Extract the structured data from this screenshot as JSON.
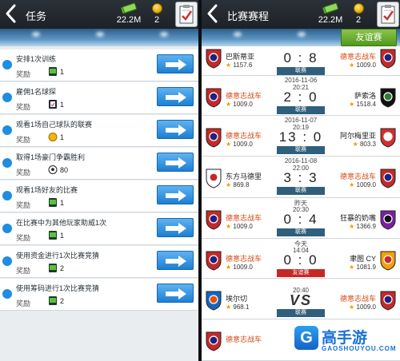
{
  "left": {
    "header": {
      "title": "任务",
      "money": "22.2M",
      "coins": "2"
    },
    "tasks": [
      {
        "desc": "安排1次训练",
        "reward_label": "奖励",
        "reward_icon": "money-icon",
        "reward_value": "1"
      },
      {
        "desc": "雇佣1名球探",
        "reward_label": "奖励",
        "reward_icon": "clipboard-icon",
        "reward_value": "1"
      },
      {
        "desc": "观看1场自己球队的联赛",
        "reward_label": "奖励",
        "reward_icon": "coin-icon",
        "reward_value": "1"
      },
      {
        "desc": "取得1场豪门争霸胜利",
        "reward_label": "奖励",
        "reward_icon": "football-icon",
        "reward_value": "80"
      },
      {
        "desc": "观看1场好友的比赛",
        "reward_label": "奖励",
        "reward_icon": "money-icon",
        "reward_value": "1"
      },
      {
        "desc": "在比赛中为其他玩家助威1次",
        "reward_label": "奖励",
        "reward_icon": "money-icon",
        "reward_value": "1"
      },
      {
        "desc": "使用资金进行1次比赛竞猜",
        "reward_label": "奖励",
        "reward_icon": "money-icon",
        "reward_value": "2"
      },
      {
        "desc": "使用筹码进行1次比赛竞猜",
        "reward_label": "奖励",
        "reward_icon": "money-icon",
        "reward_value": "2"
      }
    ]
  },
  "right": {
    "header": {
      "title": "比赛赛程",
      "money": "22.2M",
      "coins": "2"
    },
    "friendly_button": "友谊赛",
    "matches": [
      {
        "date": "",
        "time": "",
        "home": "巴斯蒂亚",
        "home_rating": "1157.6",
        "away": "德意志战车",
        "away_rating": "1009.0",
        "score": "0 : 8",
        "tag": "联赛",
        "home_mine": false,
        "away_mine": true,
        "home_colors": [
          "#c62828",
          "#1a237e"
        ],
        "away_colors": [
          "#c62828",
          "#1a237e"
        ]
      },
      {
        "date": "2016-11-06",
        "time": "20:21",
        "home": "德意志战车",
        "home_rating": "1009.0",
        "away": "萨索洛",
        "away_rating": "1518.4",
        "score": "2 : 0",
        "tag": "联赛",
        "home_mine": true,
        "away_mine": false,
        "home_colors": [
          "#c62828",
          "#1a237e"
        ],
        "away_colors": [
          "#111111",
          "#2e7d32"
        ]
      },
      {
        "date": "2016-11-07",
        "time": "20:19",
        "home": "德意志战车",
        "home_rating": "1009.0",
        "away": "阿尔梅里亚",
        "away_rating": "803.3",
        "score": "13 : 0",
        "tag": "联赛",
        "home_mine": true,
        "away_mine": false,
        "home_colors": [
          "#c62828",
          "#1a237e"
        ],
        "away_colors": [
          "#d32f2f",
          "#ffffff"
        ]
      },
      {
        "date": "2016-11-08",
        "time": "22:00",
        "home": "东方马德里",
        "home_rating": "869.8",
        "away": "德意志战车",
        "away_rating": "1009.0",
        "score": "3 : 3",
        "tag": "联赛",
        "home_mine": false,
        "away_mine": true,
        "home_colors": [
          "#ffffff",
          "#c62828"
        ],
        "away_colors": [
          "#c62828",
          "#1a237e"
        ]
      },
      {
        "date": "昨天",
        "time": "20:30",
        "home": "德意志战车",
        "home_rating": "1009.0",
        "away": "狂暴的奶嘴",
        "away_rating": "1366.9",
        "score": "0 : 4",
        "tag": "联赛",
        "home_mine": true,
        "away_mine": false,
        "home_colors": [
          "#c62828",
          "#1a237e"
        ],
        "away_colors": [
          "#7b1fa2",
          "#111111"
        ]
      },
      {
        "date": "今天",
        "time": "14:04",
        "home": "德意志战车",
        "home_rating": "1009.0",
        "away": "聿图 CY",
        "away_rating": "1081.9",
        "score": "0 : 0",
        "tag": "友谊赛",
        "tag_red": true,
        "home_mine": true,
        "away_mine": false,
        "home_colors": [
          "#c62828",
          "#1a237e"
        ],
        "away_colors": [
          "#f4a100",
          "#c62828"
        ]
      },
      {
        "date": "",
        "time": "20:40",
        "home": "埃尔切",
        "home_rating": "968.1",
        "away": "德意志战车",
        "away_rating": "1009.0",
        "score": "VS",
        "tag": "联赛",
        "home_mine": false,
        "away_mine": true,
        "home_colors": [
          "#1565c0",
          "#e65100"
        ],
        "away_colors": [
          "#c62828",
          "#1a237e"
        ]
      },
      {
        "date": "",
        "time": "",
        "home": "德意志战车",
        "home_rating": "",
        "away": "",
        "away_rating": "",
        "score": "",
        "tag": "",
        "home_mine": true,
        "away_mine": false,
        "home_colors": [
          "#c62828",
          "#1a237e"
        ],
        "away_colors": [
          "#e9edf0",
          "#e9edf0"
        ]
      }
    ]
  },
  "watermark": {
    "logo_char": "G",
    "name": "高手游",
    "url": "GAOSHOUYOU.COM"
  },
  "colors": {
    "accent_blue": "#1c7fd3",
    "friendly_green": "#4f9a1f",
    "my_team_orange": "#d14a12",
    "tag_navy": "#2f5f7c",
    "tag_red": "#c62828"
  }
}
